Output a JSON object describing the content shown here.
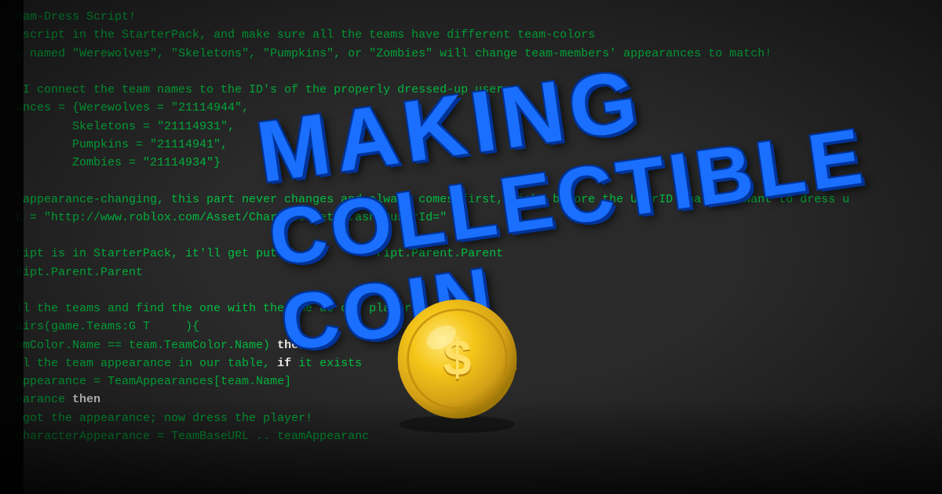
{
  "code": {
    "lines": [
      "eam-Dress Script!",
      " script in the StarterPack, and make sure all the teams have different team-colors",
      "s named \"Werewolves\", \"Skeletons\", \"Pumpkins\", or \"Zombies\" will change team-members' appearances to match!",
      "",
      " I connect the team names to the ID's of the properly dressed-up users",
      "ances = {Werewolves = \"21114944\",",
      "        Skeletons = \"21114931\",",
      "        Pumpkins = \"21114941\",",
      "        Zombies = \"21114934\"}",
      "",
      " appearance-changing, this part never changes and always comes first, right before the UserID that you want to dress u",
      "L = \"http://www.roblox.com/Asset/CharacterFetch.ashx?userId=\"",
      "",
      "ript is in StarterPack, it'll get put i            ript.Parent.Parent",
      "ript.Parent.Parent",
      "",
      "ll the teams and find the one with the  me as our player",
      "airs(game.Teams:G T     ){",
      "amColor.Name == team.TeamColor.Name) then",
      " l the team appearance in our table, if it exists",
      "Appearance = TeamAppearances[team.Name]",
      "earance then",
      " got the appearance; now dress the player!",
      "CharacterAppearance = TeamBaseURL .. teamAppearanc"
    ]
  },
  "title": {
    "making": "MAKING",
    "collectible_coin": "COLLECTIBLE COIN"
  },
  "coin": {
    "symbol": "$",
    "color_outer": "#d4a017",
    "color_inner": "#f5c518",
    "color_shine": "#ffe066"
  }
}
